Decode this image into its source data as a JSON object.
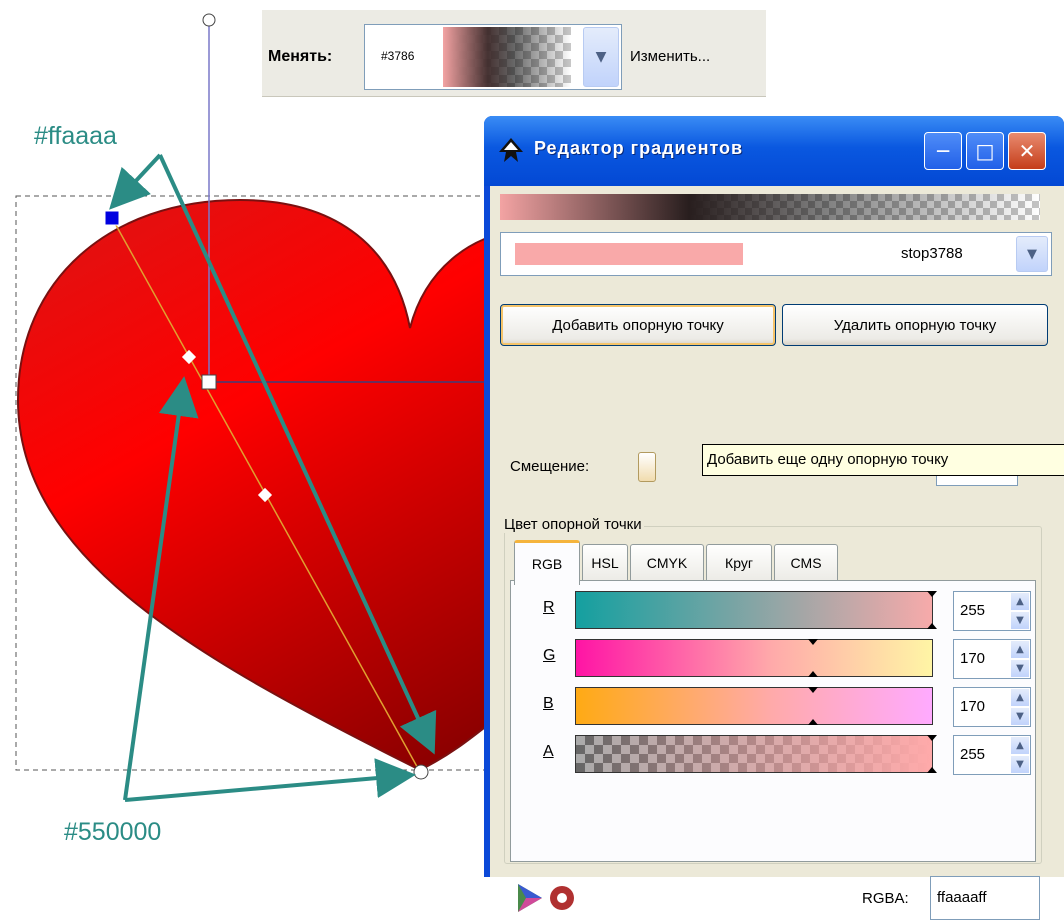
{
  "canvas": {
    "color_top_label": "#ffaaaa",
    "color_bottom_label": "#550000",
    "heart_colors": {
      "light": "#ffaaaa",
      "dark": "#550000",
      "fill": "#e00000"
    },
    "annotation_color": "#2b8c85"
  },
  "toolbar": {
    "change_label": "Менять:",
    "gradient_id": "#3786",
    "edit_button": "Изменить..."
  },
  "dialog": {
    "title": "Редактор градиентов",
    "stop_name": "stop3788",
    "stop_swatch_color": "#f9a9a9",
    "add_stop_button": "Добавить опорную точку",
    "delete_stop_button": "Удалить опорную точку",
    "offset_label": "Смещение:",
    "tooltip": "Добавить еще одну опорную точку",
    "stop_color_group": "Цвет опорной точки",
    "tabs": [
      "RGB",
      "HSL",
      "CMYK",
      "Круг",
      "CMS"
    ],
    "active_tab": "RGB",
    "channels": [
      {
        "label": "R",
        "value": "255",
        "level": 1.0
      },
      {
        "label": "G",
        "value": "170",
        "level": 0.667
      },
      {
        "label": "B",
        "value": "170",
        "level": 0.667
      },
      {
        "label": "A",
        "value": "255",
        "level": 1.0
      }
    ],
    "rgba_label": "RGBA:",
    "rgba_value": "ffaaaaff"
  }
}
